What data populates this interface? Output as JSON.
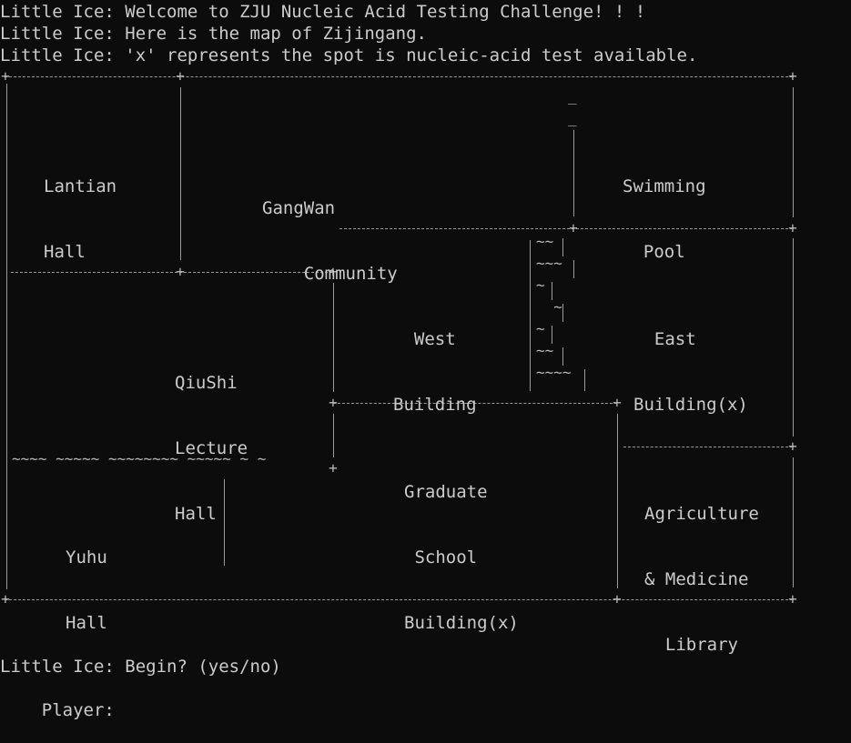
{
  "console": {
    "intro_lines": [
      "Little Ice: Welcome to ZJU Nucleic Acid Testing Challenge! ! !",
      "Little Ice: Here is the map of Zijingang.",
      "Little Ice: 'x' represents the spot is nucleic-acid test available."
    ],
    "prompt": "Little Ice: Begin? (yes/no)",
    "player_prompt": "Player:",
    "player_input": ""
  },
  "map": {
    "places": [
      {
        "id": "lantian-hall",
        "lines": [
          "Lantian",
          "Hall"
        ],
        "test_available": false
      },
      {
        "id": "gangwan-community",
        "lines": [
          "GangWan",
          "    Community"
        ],
        "test_available": false
      },
      {
        "id": "swimming-pool",
        "lines": [
          "Swimming",
          "  Pool"
        ],
        "test_available": false
      },
      {
        "id": "west-building",
        "lines": [
          "  West",
          "Building"
        ],
        "test_available": false
      },
      {
        "id": "east-building",
        "lines": [
          "  East",
          "Building(x)"
        ],
        "test_available": true
      },
      {
        "id": "qiushi-lecture-hall",
        "lines": [
          "QiuShi",
          "Lecture",
          "Hall"
        ],
        "test_available": false
      },
      {
        "id": "graduate-school-building",
        "lines": [
          "Graduate",
          " School",
          "Building(x)"
        ],
        "test_available": true
      },
      {
        "id": "agriculture-medicine-library",
        "lines": [
          "Agriculture",
          "& Medicine",
          "  Library"
        ],
        "test_available": false
      },
      {
        "id": "yuhu-hall",
        "lines": [
          "Yuhu",
          "Hall"
        ],
        "test_available": false
      }
    ],
    "river_marks": {
      "lake_line": "~~~~ ~~~~~ ~~~~~~~~ ~~~~~ ~ ~",
      "stream": [
        "~~",
        "~~~",
        "~",
        "  ~",
        "~",
        "~~",
        "~~~~"
      ],
      "gangwan_dashes": [
        "_",
        "_"
      ]
    }
  }
}
